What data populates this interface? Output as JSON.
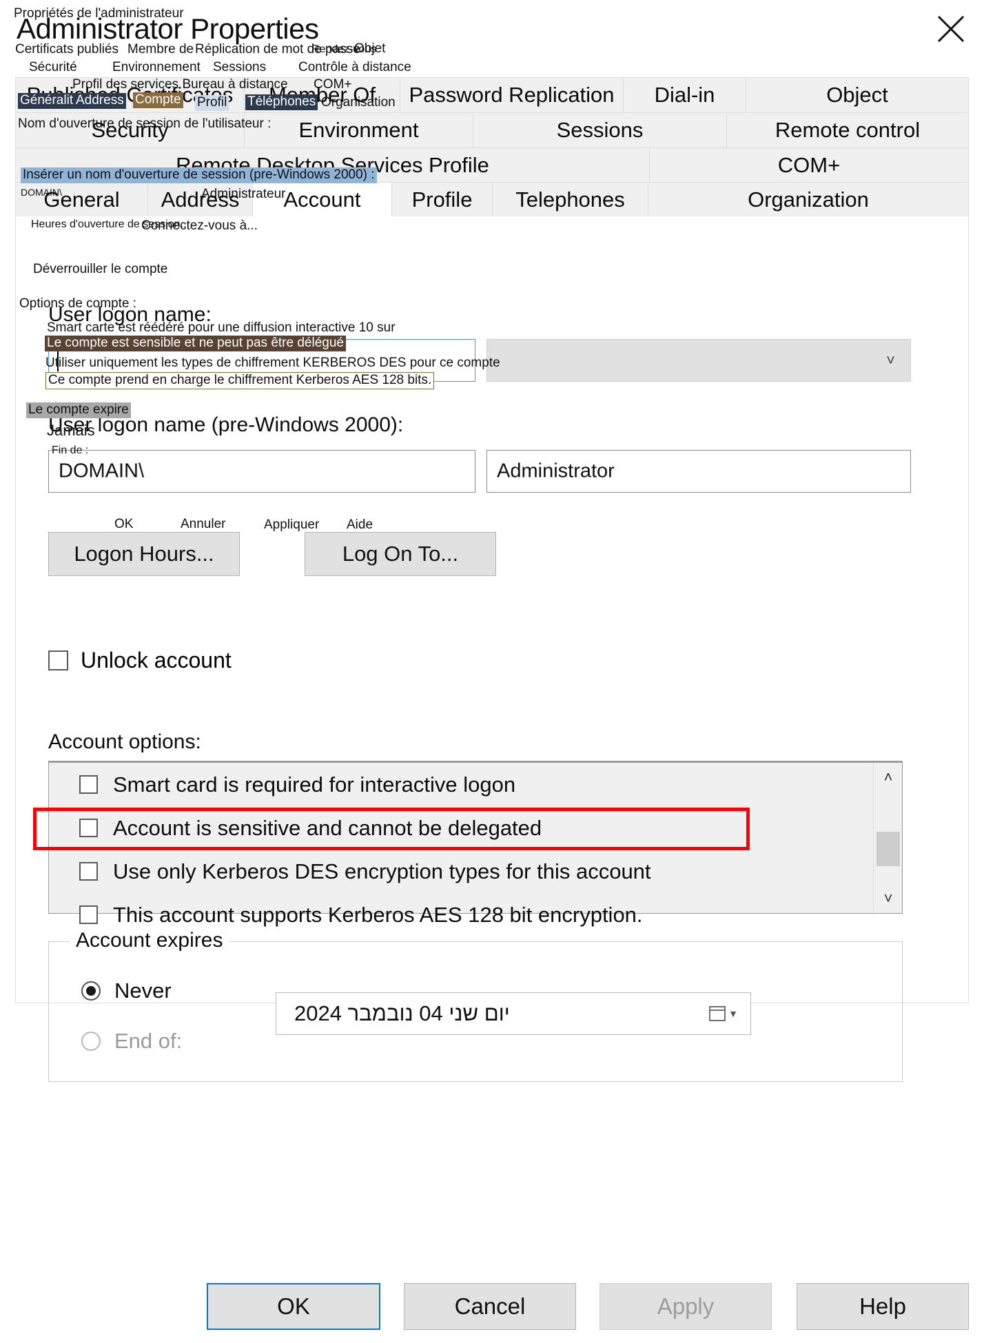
{
  "window": {
    "title": "Administrator Properties",
    "title_translation": "Propriétés de l'administrateur",
    "close_icon": "close-icon"
  },
  "tabs": {
    "row1": [
      {
        "label": "Published Certificates",
        "active": false
      },
      {
        "label": "Member Of",
        "active": false
      },
      {
        "label": "Password Replication",
        "active": false
      },
      {
        "label": "Dial-in",
        "active": false
      },
      {
        "label": "Object",
        "active": false
      }
    ],
    "row2": [
      {
        "label": "Security",
        "active": false
      },
      {
        "label": "Environment",
        "active": false
      },
      {
        "label": "Sessions",
        "active": false
      },
      {
        "label": "Remote control",
        "active": false
      }
    ],
    "row3": [
      {
        "label": "Remote Desktop Services Profile",
        "active": false
      },
      {
        "label": "COM+",
        "active": false
      }
    ],
    "row4": [
      {
        "label": "General",
        "active": false
      },
      {
        "label": "Address",
        "active": false
      },
      {
        "label": "Account",
        "active": true
      },
      {
        "label": "Profile",
        "active": false
      },
      {
        "label": "Telephones",
        "active": false
      },
      {
        "label": "Organization",
        "active": false
      }
    ]
  },
  "account_tab": {
    "user_logon_name_label": "User logon name:",
    "user_logon_name_value": "",
    "domain_suffix_value": "",
    "pre2000_label": "User logon name (pre-Windows 2000):",
    "pre2000_domain_value": "DOMAIN\\",
    "pre2000_user_value": "Administrator",
    "logon_hours_button": "Logon Hours...",
    "log_on_to_button": "Log On To...",
    "unlock_account_label": "Unlock account",
    "unlock_account_checked": false,
    "account_options_label": "Account options:",
    "options": [
      {
        "label": "Smart card is required for interactive logon",
        "checked": false,
        "highlighted": false
      },
      {
        "label": "Account is sensitive and cannot be delegated",
        "checked": false,
        "highlighted": true
      },
      {
        "label": "Use only Kerberos DES encryption types for this account",
        "checked": false,
        "highlighted": false
      },
      {
        "label": "This account supports Kerberos AES 128 bit encryption.",
        "checked": false,
        "highlighted": false
      }
    ],
    "scroll_up_icon": "chevron-up-icon",
    "scroll_down_icon": "chevron-down-icon",
    "account_expires": {
      "group_title": "Account expires",
      "never_label": "Never",
      "never_selected": true,
      "end_of_label": "End of:",
      "end_of_selected": false,
      "date_value": "יום שני  04  נובמבר  2024",
      "calendar_icon": "calendar-icon"
    }
  },
  "footer": {
    "ok": "OK",
    "cancel": "Cancel",
    "apply": "Apply",
    "apply_disabled": true,
    "help": "Help"
  },
  "french_overlay": [
    {
      "id": "tab-published-certificates",
      "text": "Certificats publiés"
    },
    {
      "id": "tab-member-of",
      "text": "Membre de"
    },
    {
      "id": "tab-password-replication",
      "text": "Réplication de mot de passe"
    },
    {
      "id": "tab-dial-in",
      "text": "Rendez-vous"
    },
    {
      "id": "tab-object",
      "text": "Objet"
    },
    {
      "id": "tab-security",
      "text": "Sécurité"
    },
    {
      "id": "tab-environment",
      "text": "Environnement"
    },
    {
      "id": "tab-sessions",
      "text": "Sessions"
    },
    {
      "id": "tab-remote-control",
      "text": "Contrôle à distance"
    },
    {
      "id": "tab-rds-profile",
      "text": "Profil des services Bureau à distance"
    },
    {
      "id": "tab-complus",
      "text": "COM+"
    },
    {
      "id": "tab-general",
      "text": "Généralités"
    },
    {
      "id": "tab-address",
      "text": "Address"
    },
    {
      "id": "tab-account",
      "text": "Compte"
    },
    {
      "id": "tab-profile",
      "text": "Profil"
    },
    {
      "id": "tab-telephones",
      "text": "Téléphones"
    },
    {
      "id": "tab-organization",
      "text": "Organisation"
    },
    {
      "id": "user-logon-name",
      "text": "Nom d'ouverture de session de l'utilisateur :"
    },
    {
      "id": "pre2000-name",
      "text": "Insérer un nom d'ouverture de session (pre-Windows 2000) :"
    },
    {
      "id": "pre2000-domain",
      "text": "DOMAIN\\"
    },
    {
      "id": "pre2000-user",
      "text": "Administrateur"
    },
    {
      "id": "logon-hours",
      "text": "Heures d'ouverture de session..."
    },
    {
      "id": "log-on-to",
      "text": "Connectez-vous à..."
    },
    {
      "id": "unlock-account",
      "text": "Déverrouiller le compte"
    },
    {
      "id": "account-options",
      "text": "Options de compte :"
    },
    {
      "id": "opt-smart-card",
      "text": "Smart carte est réédéré pour une diffusion interactive 10 sur"
    },
    {
      "id": "opt-sensitive",
      "text": "Le compte est sensible et ne peut pas être délégué"
    },
    {
      "id": "opt-des",
      "text": "Utiliser uniquement les types de chiffrement KERBEROS DES pour ce compte"
    },
    {
      "id": "opt-aes",
      "text": "Ce compte prend en charge le chiffrement Kerberos AES 128 bits."
    },
    {
      "id": "account-expires",
      "text": "Le compte expire"
    },
    {
      "id": "never",
      "text": "Jamais"
    },
    {
      "id": "end-of",
      "text": "Fin de :"
    },
    {
      "id": "btn-ok",
      "text": "OK"
    },
    {
      "id": "btn-cancel",
      "text": "Annuler"
    },
    {
      "id": "btn-apply",
      "text": "Appliquer"
    },
    {
      "id": "btn-help",
      "text": "Aide"
    }
  ],
  "colors": {
    "highlight_box": "#ff0000",
    "focus_border": "#4a9ae0",
    "accent": "#0078d7"
  }
}
